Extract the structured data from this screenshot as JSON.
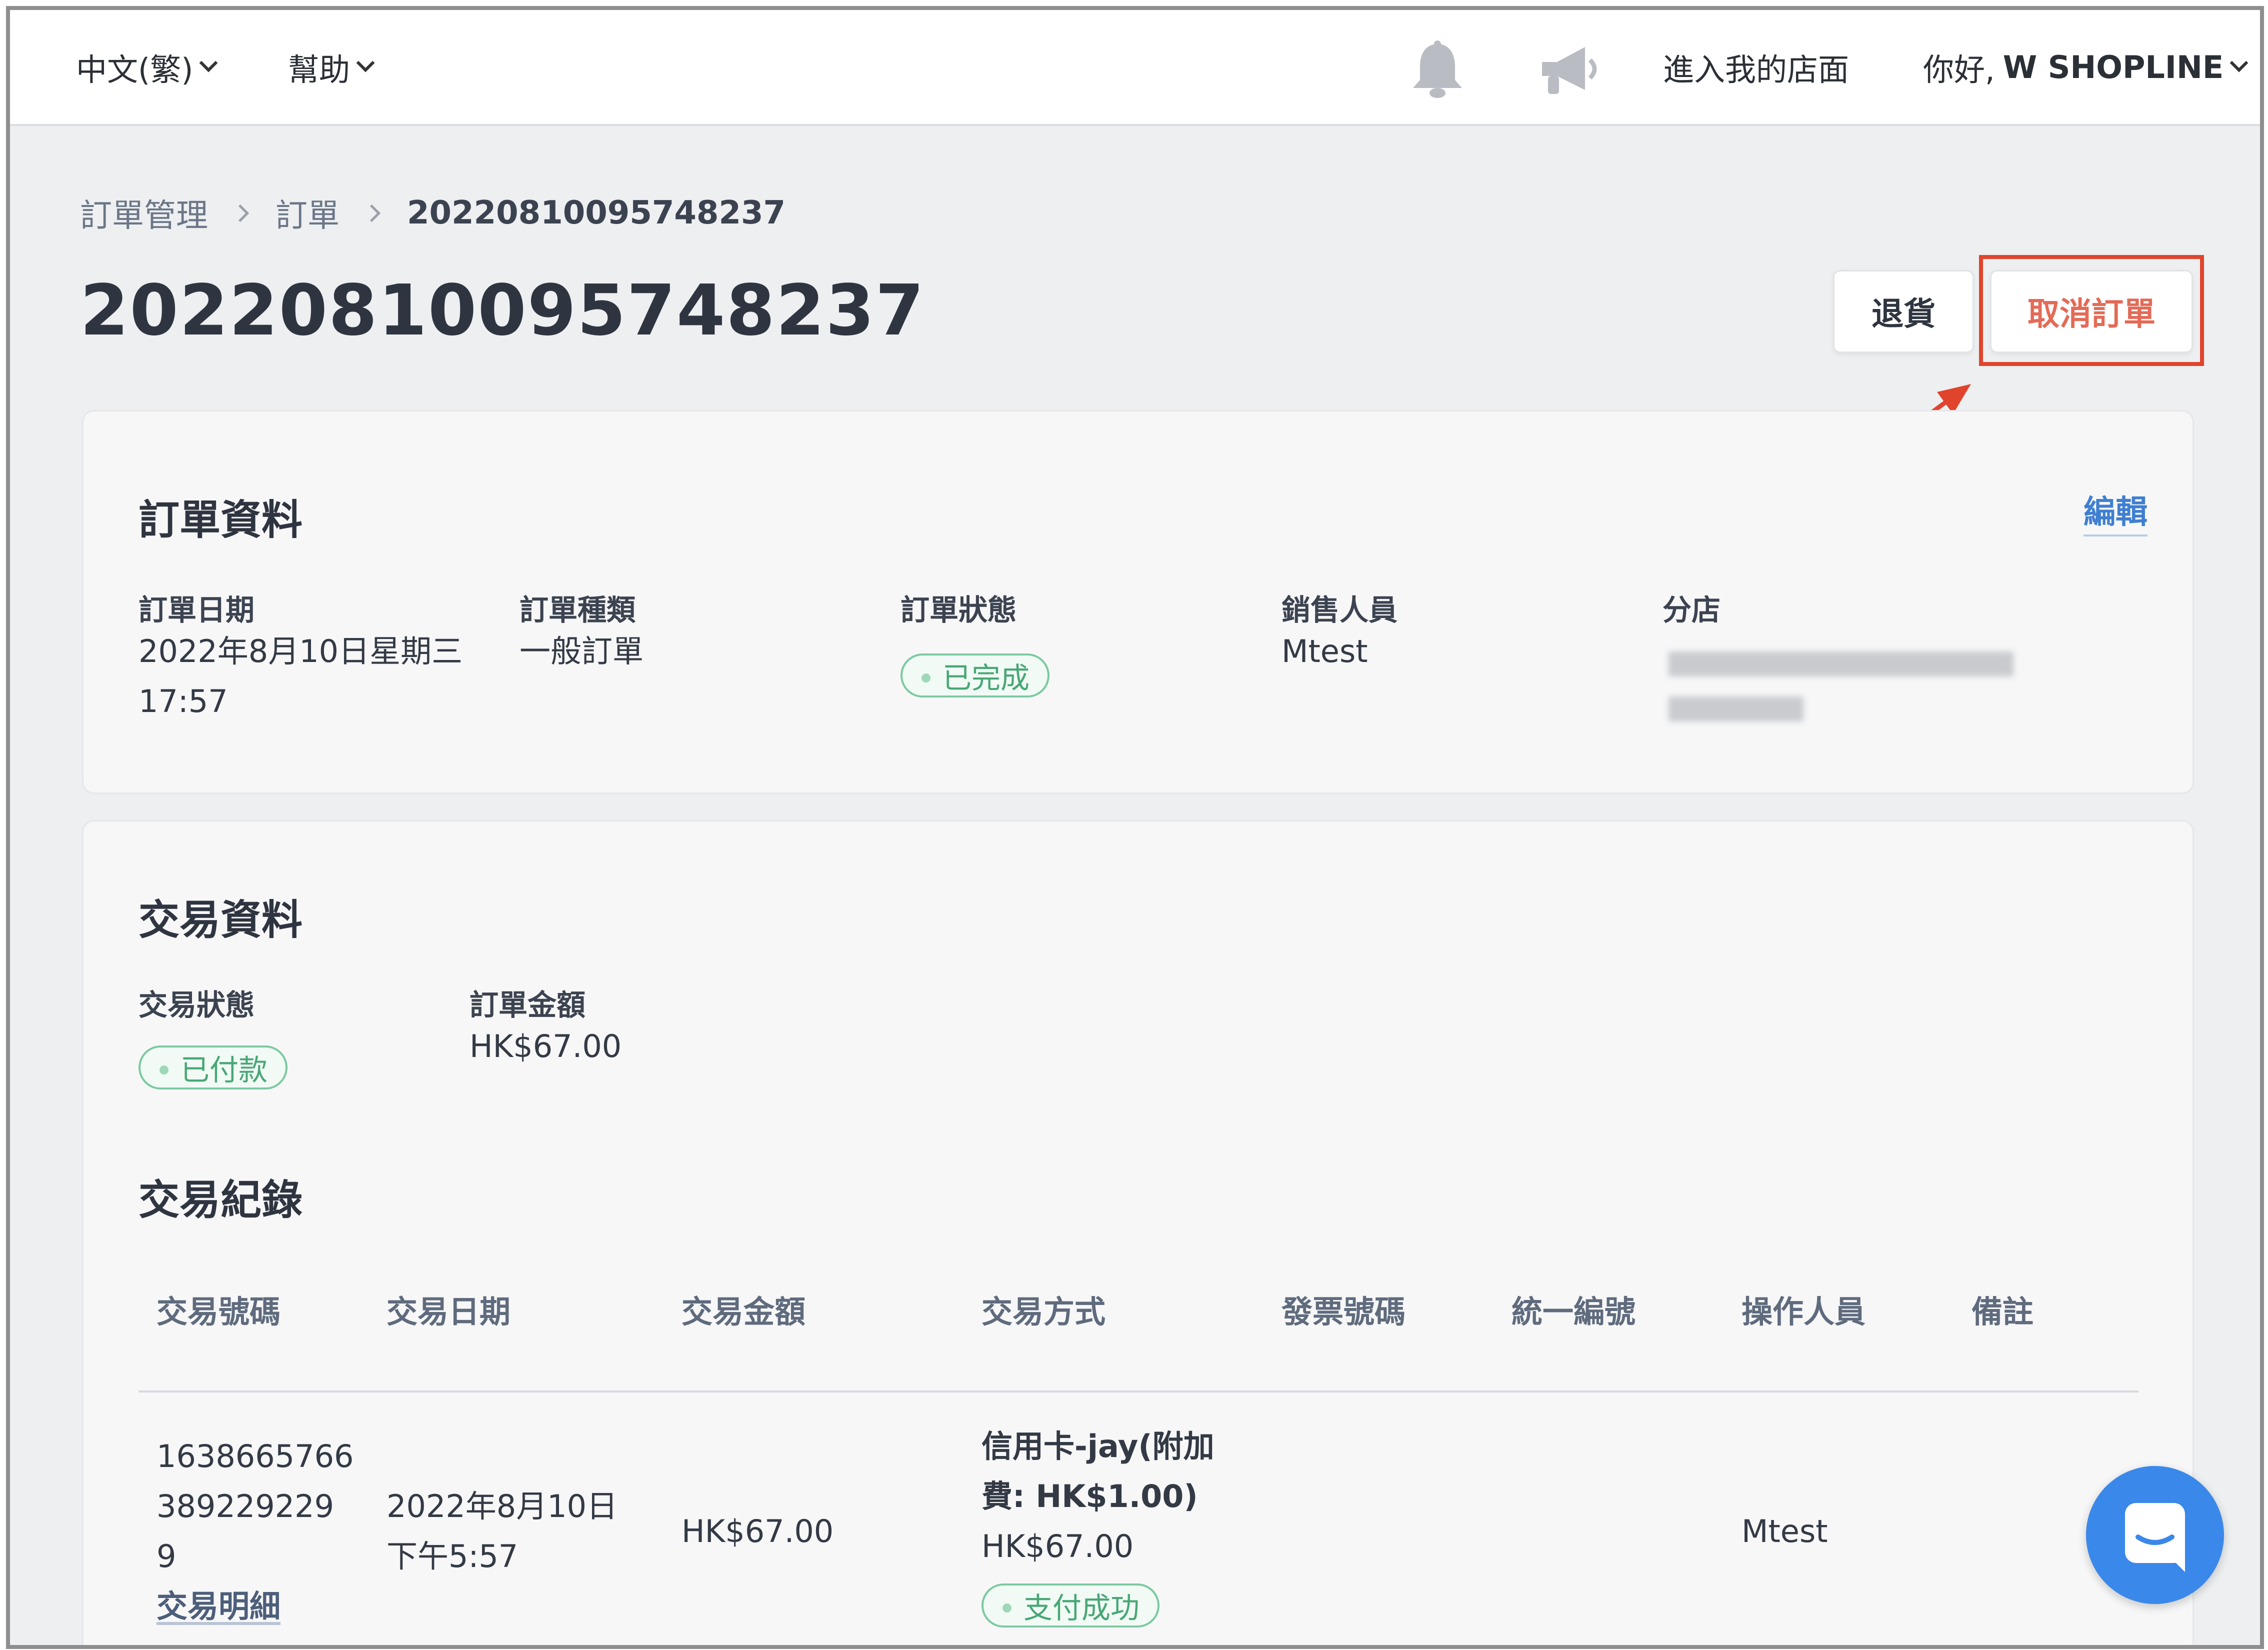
{
  "topbar": {
    "language": "中文(繁)",
    "help": "幫助",
    "enter_store": "進入我的店面",
    "greeting_prefix": "你好,",
    "user_name": "W SHOPLINE"
  },
  "breadcrumb": {
    "items": [
      "訂單管理",
      "訂單"
    ],
    "current": "20220810095748237"
  },
  "page": {
    "title": "20220810095748237",
    "return_button": "退貨",
    "cancel_button": "取消訂單"
  },
  "order_info": {
    "title": "訂單資料",
    "edit": "編輯",
    "fields": {
      "date_label": "訂單日期",
      "date_value_line1": "2022年8月10日星期三",
      "date_value_line2": "17:57",
      "type_label": "訂單種類",
      "type_value": "一般訂單",
      "status_label": "訂單狀態",
      "status_value": "已完成",
      "sales_label": "銷售人員",
      "sales_value": "Mtest",
      "branch_label": "分店"
    }
  },
  "transaction_info": {
    "title": "交易資料",
    "status_label": "交易狀態",
    "status_value": "已付款",
    "amount_label": "訂單金額",
    "amount_value": "HK$67.00",
    "records_title": "交易紀錄",
    "columns": [
      "交易號碼",
      "交易日期",
      "交易金額",
      "交易方式",
      "發票號碼",
      "統一編號",
      "操作人員",
      "備註"
    ],
    "rows": [
      {
        "number_line1": "1638665766",
        "number_line2": "389229229",
        "number_line3": "9",
        "detail_link": "交易明細",
        "date_line1": "2022年8月10日",
        "date_line2": "下午5:57",
        "amount": "HK$67.00",
        "method_line1": "信用卡-jay(附加",
        "method_line2": "費: HK$1.00)",
        "method_line3": "HK$67.00",
        "method_status": "支付成功",
        "operator": "Mtest"
      }
    ]
  },
  "colors": {
    "accent_blue": "#3f7fd1",
    "cancel_red": "#e36b57",
    "highlight_red": "#e0442c",
    "success_green": "#48a775",
    "chat_blue": "#3a88ea"
  }
}
